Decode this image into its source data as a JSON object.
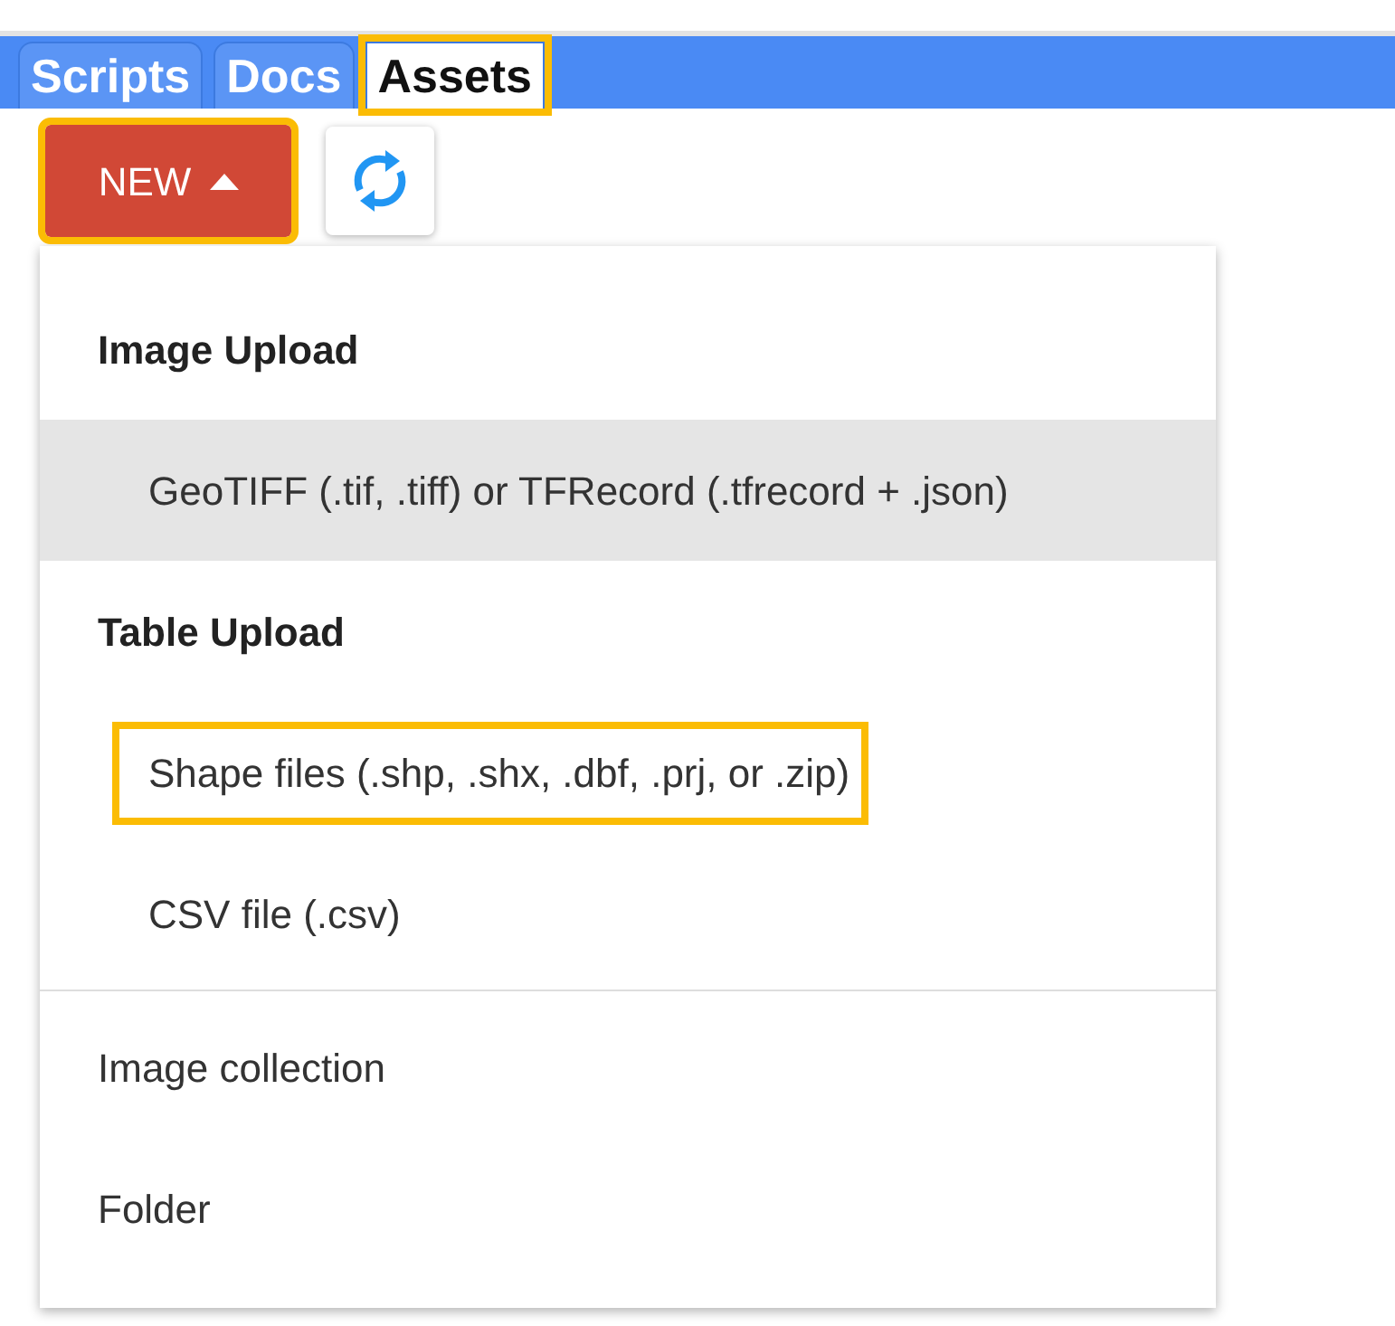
{
  "tabs": [
    {
      "label": "Scripts",
      "selected": false,
      "highlighted": false
    },
    {
      "label": "Docs",
      "selected": false,
      "highlighted": false
    },
    {
      "label": "Assets",
      "selected": true,
      "highlighted": true
    }
  ],
  "new_button": {
    "label": "NEW",
    "highlighted": true
  },
  "menu": [
    {
      "kind": "header",
      "label": "Image Upload"
    },
    {
      "kind": "subitem",
      "label": "GeoTIFF (.tif, .tiff) or TFRecord (.tfrecord + .json)",
      "hovered": true,
      "highlighted": false
    },
    {
      "kind": "header",
      "label": "Table Upload"
    },
    {
      "kind": "subitem",
      "label": "Shape files (.shp, .shx, .dbf, .prj, or .zip)",
      "hovered": false,
      "highlighted": true
    },
    {
      "kind": "subitem",
      "label": "CSV file (.csv)",
      "hovered": false,
      "highlighted": false
    },
    {
      "kind": "divider"
    },
    {
      "kind": "item",
      "label": "Image collection",
      "hovered": false,
      "highlighted": false
    },
    {
      "kind": "item",
      "label": "Folder",
      "hovered": false,
      "highlighted": false
    }
  ]
}
